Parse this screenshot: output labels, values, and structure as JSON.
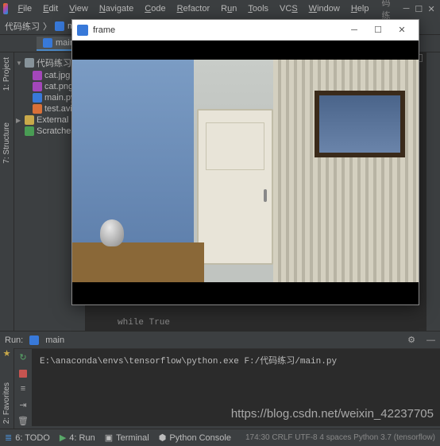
{
  "menubar": {
    "items": [
      "File",
      "Edit",
      "View",
      "Navigate",
      "Code",
      "Refactor",
      "Run",
      "Tools",
      "VCS",
      "Window",
      "Help"
    ],
    "title": "代码练习"
  },
  "crumb": {
    "project": "代码练习",
    "file": "main.py"
  },
  "tabbar": {
    "tab": "main.py"
  },
  "tree": {
    "root": "代码练习",
    "files": [
      "cat.jpg",
      "cat.png",
      "main.py",
      "test.avi"
    ],
    "libs": "External Li",
    "scratches": "Scratches"
  },
  "editor": {
    "visible_code": "while True"
  },
  "framewin": {
    "title": "frame"
  },
  "run": {
    "label": "Run:",
    "config": "main",
    "output": "E:\\anaconda\\envs\\tensorflow\\python.exe F:/代码练习/main.py"
  },
  "bottombar": {
    "todo": "6: TODO",
    "run": "4: Run",
    "terminal": "Terminal",
    "pyconsole": "Python Console",
    "status": "174:30  CRLF  UTF-8  4 spaces  Python 3.7 (tensorflow)"
  },
  "leftstrip": {
    "project": "1: Project",
    "structure": "7: Structure"
  },
  "leftstrip2": {
    "favorites": "2: Favorites"
  },
  "watermark": "https://blog.csdn.net/weixin_42237705"
}
